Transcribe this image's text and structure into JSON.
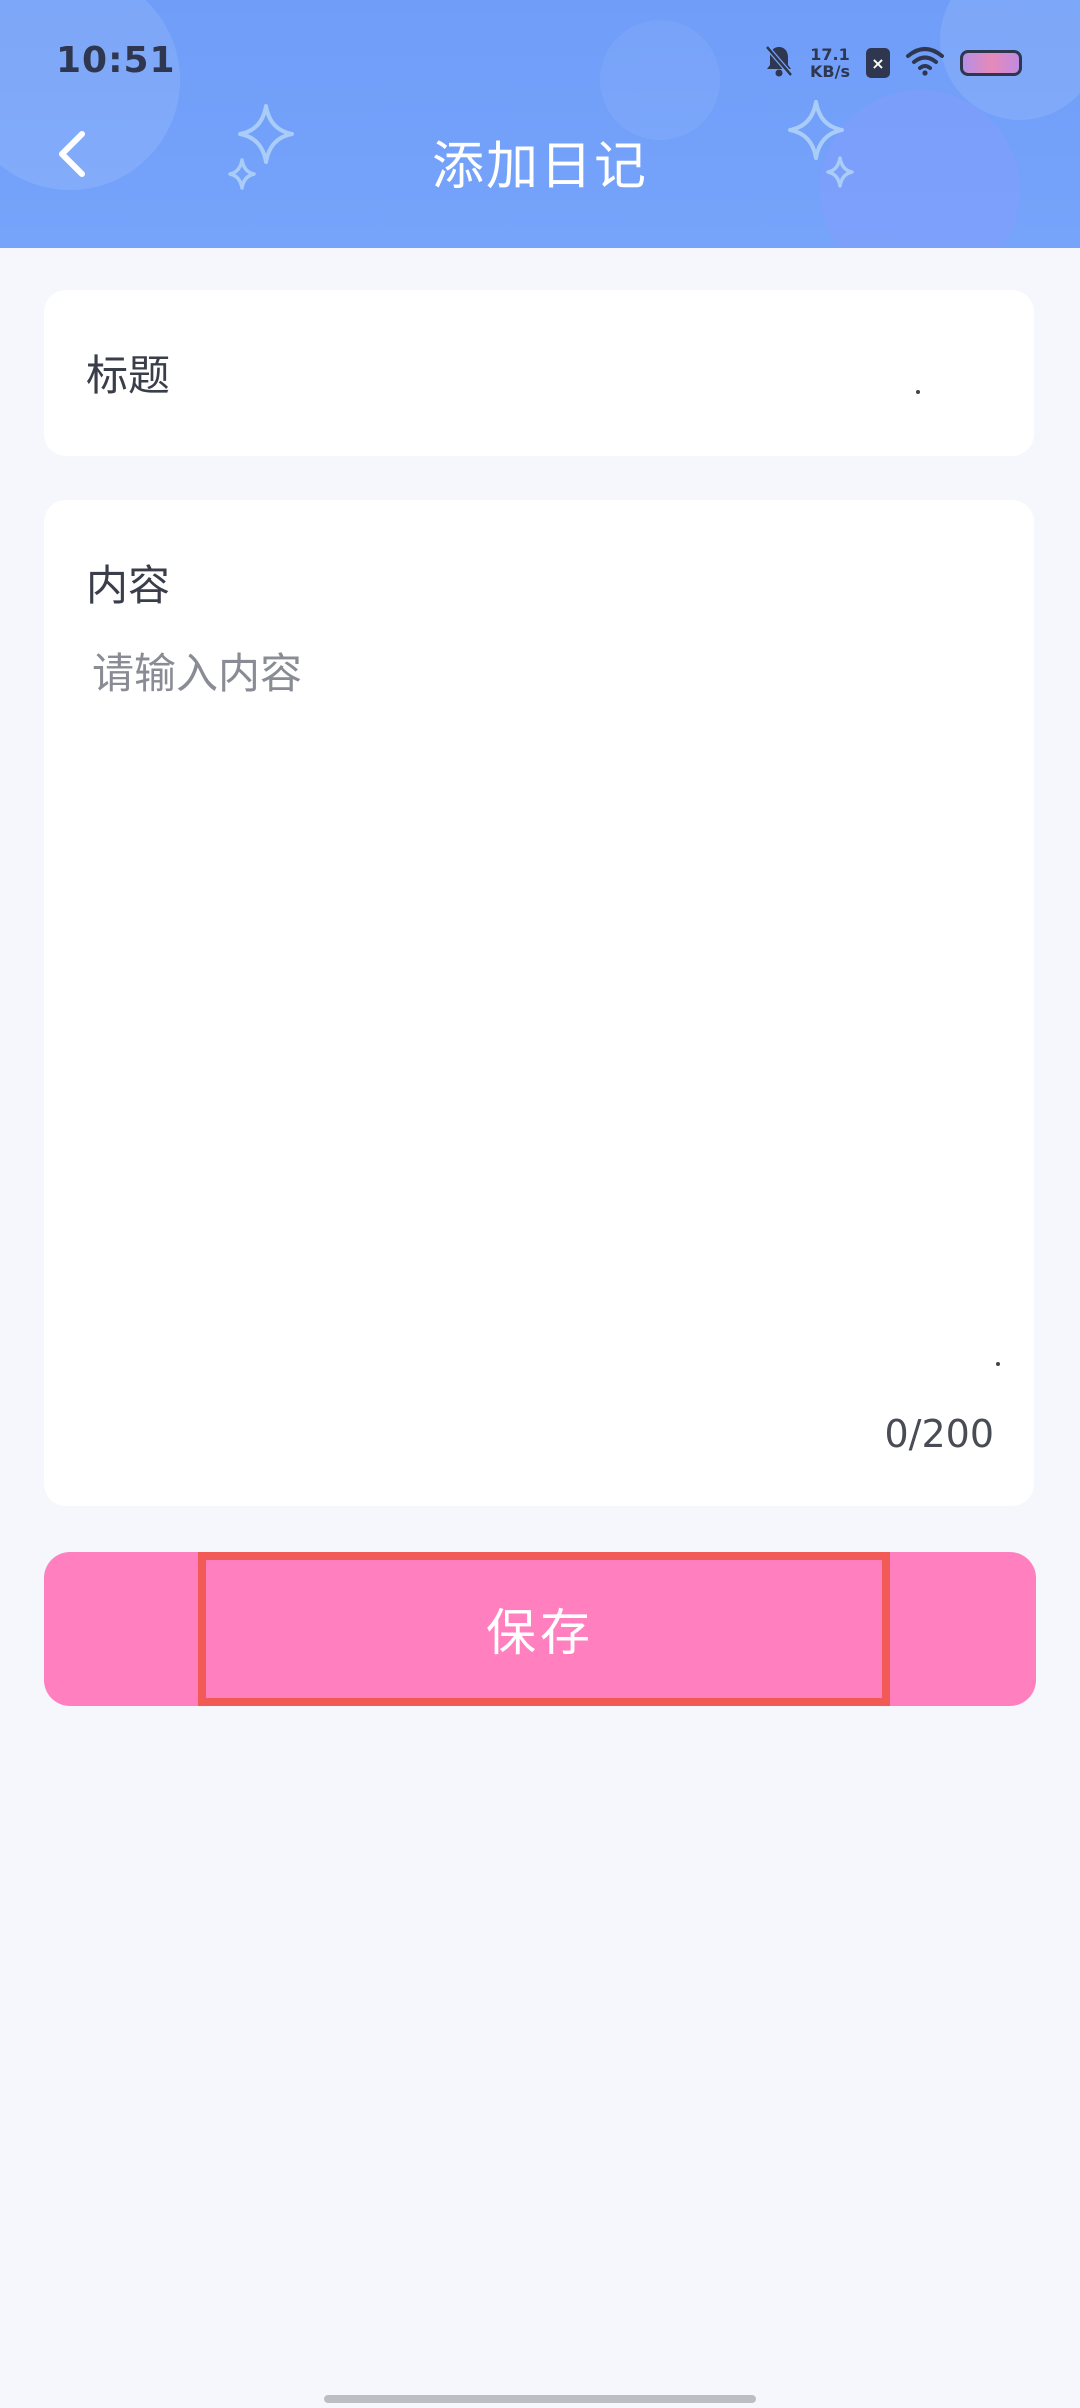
{
  "status_bar": {
    "time": "10:51",
    "net_speed_value": "17.1",
    "net_speed_unit": "KB/s",
    "sim_badge": "×"
  },
  "header": {
    "title": "添加日记",
    "back_icon": "chevron-left-icon"
  },
  "title_field": {
    "label": "标题",
    "value": ""
  },
  "content_field": {
    "label": "内容",
    "placeholder": "请输入内容",
    "value": "",
    "counter": "0/200"
  },
  "save_button": {
    "label": "保存",
    "color": "#ff7fbf"
  },
  "colors": {
    "header_bg": "#76a4fb",
    "page_bg": "#f6f7fc",
    "highlight": "#f25a55"
  }
}
